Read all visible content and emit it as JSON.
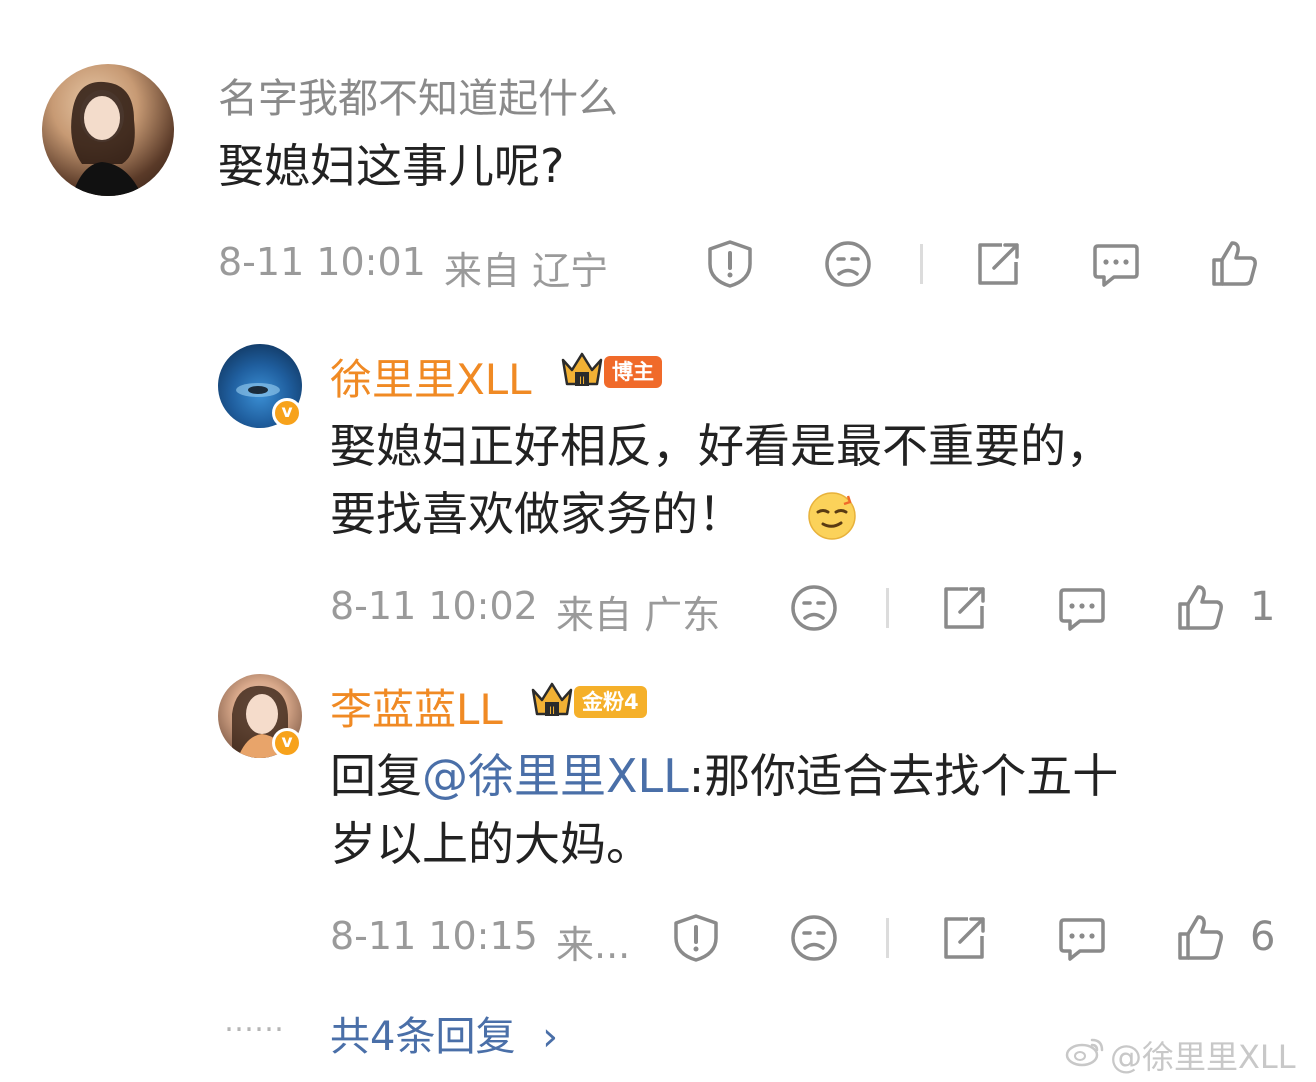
{
  "colors": {
    "accent_orange": "#f08a24",
    "link_blue": "#4a6fa8",
    "meta_gray": "#9a9a9a"
  },
  "comment": {
    "user": "名字我都不知道起什么",
    "text": "娶媳妇这事儿呢?",
    "time": "8-11 10:01",
    "location": "来自 辽宁",
    "icons": [
      "report-icon",
      "dislike-icon",
      "share-icon",
      "comment-icon",
      "like-icon"
    ]
  },
  "reply1": {
    "user": "徐里里XLL",
    "badge": "博主",
    "verified_mark": "v",
    "line1": "娶媳妇正好相反，好看是最不重要的，",
    "line2": "要找喜欢做家务的！",
    "emoji": "sweat-smile-emoji",
    "time": "8-11 10:02",
    "location": "来自 广东",
    "like_count": "1"
  },
  "reply2": {
    "user": "李蓝蓝LL",
    "badge": "金粉4",
    "verified_mark": "v",
    "prefix": "回复",
    "mention": "@徐里里XLL",
    "line1_rest": ":那你适合去找个五十",
    "line2": "岁以上的大妈。",
    "time": "8-11 10:15",
    "location": "来...",
    "like_count": "6"
  },
  "more_replies": {
    "dots": "……",
    "label": "共4条回复",
    "chevron": "›"
  },
  "watermark": "@徐里里XLL"
}
